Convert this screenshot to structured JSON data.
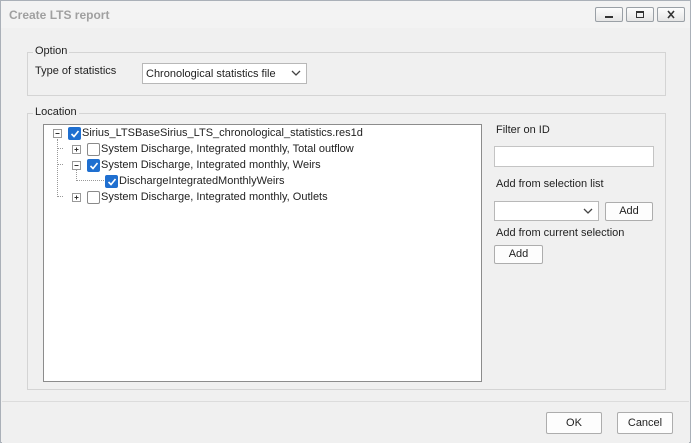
{
  "window": {
    "title": "Create LTS report"
  },
  "option": {
    "group_label": "Option",
    "type_label": "Type of statistics",
    "type_value": "Chronological statistics file"
  },
  "location": {
    "group_label": "Location",
    "tree": {
      "root": {
        "label": "Sirius_LTSBaseSirius_LTS_chronological_statistics.res1d",
        "checked": true,
        "expanded": true
      },
      "items": [
        {
          "label": "System Discharge, Integrated monthly, Total outflow",
          "checked": false,
          "expanded": false
        },
        {
          "label": "System Discharge, Integrated monthly, Weirs",
          "checked": true,
          "expanded": true,
          "children": [
            {
              "label": "DischargeIntegratedMonthlyWeirs",
              "checked": true
            }
          ]
        },
        {
          "label": "System Discharge, Integrated monthly, Outlets",
          "checked": false,
          "expanded": false
        }
      ]
    },
    "filter_label": "Filter on ID",
    "filter_value": "",
    "selection_list_label": "Add from selection list",
    "selection_list_value": "",
    "add_label": "Add",
    "current_selection_label": "Add from current selection",
    "add_current_label": "Add"
  },
  "footer": {
    "ok_label": "OK",
    "cancel_label": "Cancel"
  },
  "colors": {
    "check_blue": "#1f6fd0"
  }
}
